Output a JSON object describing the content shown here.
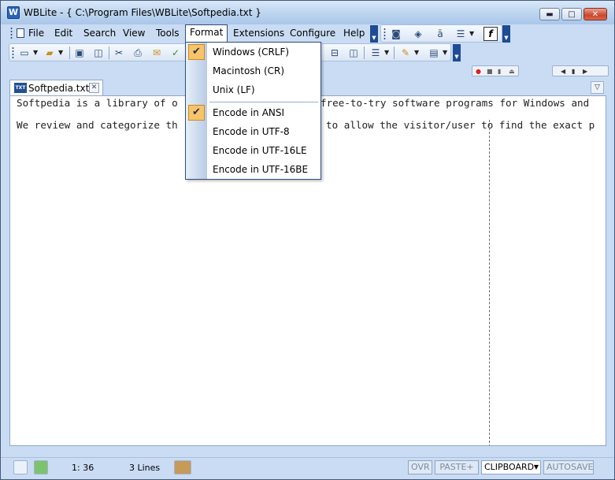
{
  "window": {
    "title": "WBLite - { C:\\Program Files\\WBLite\\Softpedia.txt }",
    "app_icon_letter": "W",
    "controls": {
      "minimize": "▬",
      "maximize": "□",
      "close": "✕"
    }
  },
  "menu": {
    "items": [
      "File",
      "Edit",
      "Search",
      "View",
      "Tools",
      "Format",
      "Extensions",
      "Configure",
      "Help"
    ]
  },
  "format_menu": {
    "items": [
      {
        "label": "Windows (CRLF)",
        "checked": true
      },
      {
        "label": "Macintosh (CR)",
        "checked": false
      },
      {
        "label": "Unix (LF)",
        "checked": false
      },
      {
        "label": "Encode in ANSI",
        "checked": true
      },
      {
        "label": "Encode in UTF-8",
        "checked": false
      },
      {
        "label": "Encode in UTF-16LE",
        "checked": false
      },
      {
        "label": "Encode in UTF-16BE",
        "checked": false
      }
    ],
    "check_glyph": "✔"
  },
  "tabs": [
    {
      "label": "Softpedia.txt",
      "icon_text": "TXT",
      "close": "✕"
    }
  ],
  "editor": {
    "lines": [
      "Softpedia is a library of o",
      "free-to-try software programs for Windows and",
      "We review and categorize th",
      "to allow the visitor/user to find the exact p"
    ]
  },
  "scrollbar": {
    "thumb_grip": "|||"
  },
  "status": {
    "position": "1: 36",
    "lines": "3 Lines",
    "ovr": "OVR",
    "paste": "PASTE+",
    "clipboard": "CLIPBOARD",
    "autosave": "AUTOSAVE"
  },
  "colors": {
    "window_bg": "#c9dcf3",
    "menu_highlight": "#f8c46a",
    "toolbar_end": "#1f4b95"
  }
}
